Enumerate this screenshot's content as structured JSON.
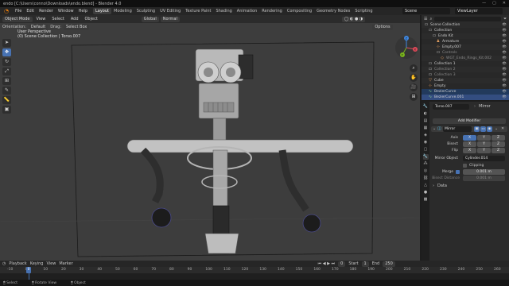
{
  "window": {
    "title": "endo [C:\\Users\\conno\\Downloads\\endo.blend] - Blender 4.0",
    "controls": [
      "—",
      "▢",
      "✕"
    ]
  },
  "menu": {
    "items": [
      "File",
      "Edit",
      "Render",
      "Window",
      "Help"
    ],
    "workspaces": [
      "Layout",
      "Modeling",
      "Sculpting",
      "UV Editing",
      "Texture Paint",
      "Shading",
      "Animation",
      "Rendering",
      "Compositing",
      "Geometry Nodes",
      "Scripting"
    ],
    "active_workspace": "Layout",
    "scene": "Scene",
    "view_layer": "ViewLayer"
  },
  "viewport": {
    "mode": "Object Mode",
    "view": "View",
    "select": "Select",
    "add": "Add",
    "object": "Object",
    "transform_orientation": "Global",
    "orientation_label": "Orientation:",
    "orientation_value": "Default",
    "drag_label": "Drag:",
    "drag_value": "Select Box",
    "pivot": "Normal",
    "options": "Options",
    "info_line1": "User Perspective",
    "info_line2": "(0) Scene Collection | Torso.007",
    "tools": [
      {
        "icon": "cursor-icon",
        "glyph": "➤",
        "active": false
      },
      {
        "icon": "move-icon",
        "glyph": "✥",
        "active": true
      },
      {
        "icon": "rotate-icon",
        "glyph": "↻",
        "active": false
      },
      {
        "icon": "scale-icon",
        "glyph": "⤢",
        "active": false
      },
      {
        "icon": "transform-icon",
        "glyph": "⊞",
        "active": false
      },
      {
        "icon": "annotate-icon",
        "glyph": "✎",
        "active": false
      },
      {
        "icon": "measure-icon",
        "glyph": "📏",
        "active": false
      },
      {
        "icon": "add-cube-icon",
        "glyph": "▣",
        "active": false
      }
    ],
    "gizmo_axes": [
      "X",
      "Y",
      "Z"
    ]
  },
  "outliner": {
    "search_placeholder": "",
    "rows": [
      {
        "label": "Scene Collection",
        "icon": "collection-icon",
        "indent": 0,
        "color": "#cfcfcf",
        "state": ""
      },
      {
        "label": "Collection",
        "icon": "collection-icon",
        "indent": 1,
        "color": "#cfcfcf",
        "state": ""
      },
      {
        "label": "Endo Kit",
        "icon": "collection-icon",
        "indent": 2,
        "color": "#cfcfcf",
        "state": ""
      },
      {
        "label": "Armature",
        "icon": "armature-icon",
        "indent": 3,
        "color": "#cfcfcf",
        "state": ""
      },
      {
        "label": "Empty.007",
        "icon": "empty-icon",
        "indent": 3,
        "color": "#cfcfcf",
        "state": ""
      },
      {
        "label": "Controls",
        "icon": "collection-icon",
        "indent": 3,
        "color": "#8a8a8a",
        "state": ""
      },
      {
        "label": "WGT_Endo_Rings_Kit.002",
        "icon": "object-icon",
        "indent": 4,
        "color": "#8a8a8a",
        "state": ""
      },
      {
        "label": "Collection 1",
        "icon": "collection-icon",
        "indent": 1,
        "color": "#cfcfcf",
        "state": ""
      },
      {
        "label": "Collection 2",
        "icon": "collection-icon",
        "indent": 1,
        "color": "#8a8a8a",
        "state": ""
      },
      {
        "label": "Collection 3",
        "icon": "collection-icon",
        "indent": 1,
        "color": "#8a8a8a",
        "state": ""
      },
      {
        "label": "Cube",
        "icon": "mesh-icon",
        "indent": 1,
        "color": "#cfcfcf",
        "state": ""
      },
      {
        "label": "Empty",
        "icon": "empty-icon",
        "indent": 1,
        "color": "#cfcfcf",
        "state": ""
      },
      {
        "label": "BezierCurve",
        "icon": "curve-icon",
        "indent": 1,
        "color": "#cfcfcf",
        "state": "hl"
      },
      {
        "label": "BezierCurve.001",
        "icon": "curve-icon",
        "indent": 1,
        "color": "#cfcfcf",
        "state": "sel"
      }
    ]
  },
  "properties": {
    "object_name": "Torso.007",
    "modifier_context": "Mirror",
    "add_modifier": "Add Modifier",
    "modifier_name": "Mirror",
    "axis_label": "Axis",
    "bisect_label": "Bisect",
    "flip_label": "Flip",
    "axes": [
      "X",
      "Y",
      "Z"
    ],
    "mirror_object_label": "Mirror Object",
    "mirror_object_value": "Cylinder.014",
    "clipping_label": "Clipping",
    "merge_label": "Merge",
    "merge_value": "0.001 m",
    "bisect_distance_label": "Bisect Distance",
    "bisect_distance_value": "0.001 m",
    "data_label": "Data",
    "tabs": [
      {
        "icon": "tool-tab-icon",
        "glyph": "🔧",
        "active": false
      },
      {
        "icon": "render-tab-icon",
        "glyph": "◐",
        "active": false
      },
      {
        "icon": "output-tab-icon",
        "glyph": "▤",
        "active": false
      },
      {
        "icon": "view-layer-tab-icon",
        "glyph": "▦",
        "active": false
      },
      {
        "icon": "scene-tab-icon",
        "glyph": "◈",
        "active": false
      },
      {
        "icon": "world-tab-icon",
        "glyph": "◉",
        "active": false
      },
      {
        "icon": "object-tab-icon",
        "glyph": "▢",
        "active": false
      },
      {
        "icon": "modifier-tab-icon",
        "glyph": "🔧",
        "active": true
      },
      {
        "icon": "particles-tab-icon",
        "glyph": "⁂",
        "active": false
      },
      {
        "icon": "physics-tab-icon",
        "glyph": "◎",
        "active": false
      },
      {
        "icon": "constraints-tab-icon",
        "glyph": "⛓",
        "active": false
      },
      {
        "icon": "data-tab-icon",
        "glyph": "△",
        "active": false
      },
      {
        "icon": "material-tab-icon",
        "glyph": "●",
        "active": false
      },
      {
        "icon": "texture-tab-icon",
        "glyph": "▩",
        "active": false
      }
    ]
  },
  "timeline": {
    "playback": "Playback",
    "keying": "Keying",
    "view": "View",
    "marker": "Marker",
    "current_frame": "0",
    "start_label": "Start",
    "start_value": "1",
    "end_label": "End",
    "end_value": "250",
    "ticks": [
      "-10",
      "0",
      "10",
      "20",
      "30",
      "40",
      "50",
      "60",
      "70",
      "80",
      "90",
      "100",
      "110",
      "120",
      "130",
      "140",
      "150",
      "160",
      "170",
      "180",
      "190",
      "200",
      "210",
      "220",
      "230",
      "240",
      "250",
      "260"
    ]
  },
  "statusbar": {
    "items": [
      "Select",
      "Rotate View",
      "Object"
    ]
  },
  "colors": {
    "accent": "#4772b3",
    "blender_orange": "#e87d0d",
    "viewport_bg": "#3d3d3d",
    "panel_bg": "#2b2b2b"
  }
}
